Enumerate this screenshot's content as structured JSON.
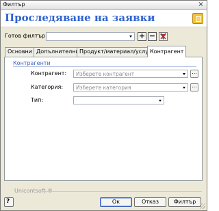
{
  "window": {
    "title": "Филтър",
    "close_glyph": "×"
  },
  "header": {
    "title": "Проследяване на заявки",
    "icon": "dialog-app-icon"
  },
  "ready_filter": {
    "label": "Готов филтър:",
    "value": "",
    "add_glyph": "+",
    "remove_glyph": "−"
  },
  "tabs": [
    {
      "label": "Основни",
      "active": false
    },
    {
      "label": "Допълнителни",
      "active": false
    },
    {
      "label": "Продукт/материал/услуга",
      "active": false
    },
    {
      "label": "Контрагент",
      "active": true
    }
  ],
  "contragent_group": {
    "title": "Контрагенти",
    "fields": [
      {
        "label": "Контрагент:",
        "placeholder": "Изберете контрагент",
        "browse": "..."
      },
      {
        "label": "Категория:",
        "placeholder": "Изберете категория",
        "browse": "..."
      },
      {
        "label": "Тип:",
        "placeholder": ""
      }
    ]
  },
  "footer": {
    "brand": "Unicontsoft ®"
  },
  "buttons": {
    "ok": "Ок",
    "cancel": "Отказ",
    "filter": "Филтър"
  },
  "colors": {
    "header_title": "#2f63cf",
    "group_title": "#3a5fbf",
    "dialog_bg": "#ece9d8"
  }
}
